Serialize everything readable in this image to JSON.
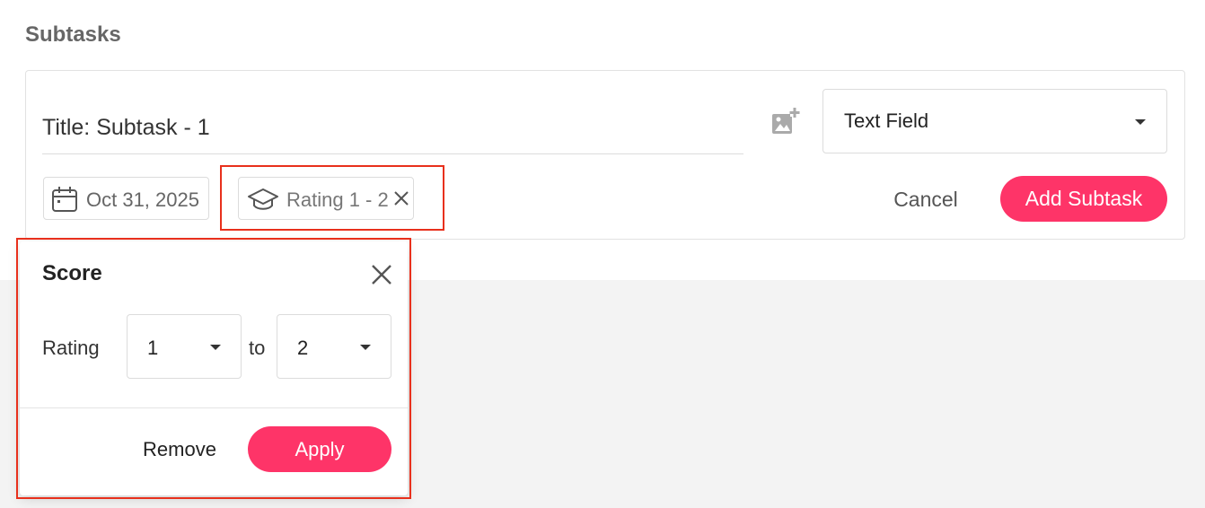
{
  "section": {
    "title": "Subtasks"
  },
  "subtask": {
    "title_value": "Title: Subtask - 1",
    "add_image_icon": "image-plus-icon",
    "type_select": {
      "value": "Text Field"
    },
    "due_date": {
      "icon": "calendar-icon",
      "label": "Oct 31, 2025"
    },
    "rating_chip": {
      "icon": "graduation-cap-icon",
      "label": "Rating 1 - 2",
      "clear_icon": "close-icon"
    },
    "cancel_label": "Cancel",
    "add_label": "Add Subtask"
  },
  "score_popover": {
    "title": "Score",
    "rating_label": "Rating",
    "from_value": "1",
    "to_label": "to",
    "to_value": "2",
    "remove_label": "Remove",
    "apply_label": "Apply"
  },
  "colors": {
    "accent": "#fe3468",
    "highlight": "#e8301c",
    "muted_bg": "#f3f3f3"
  }
}
